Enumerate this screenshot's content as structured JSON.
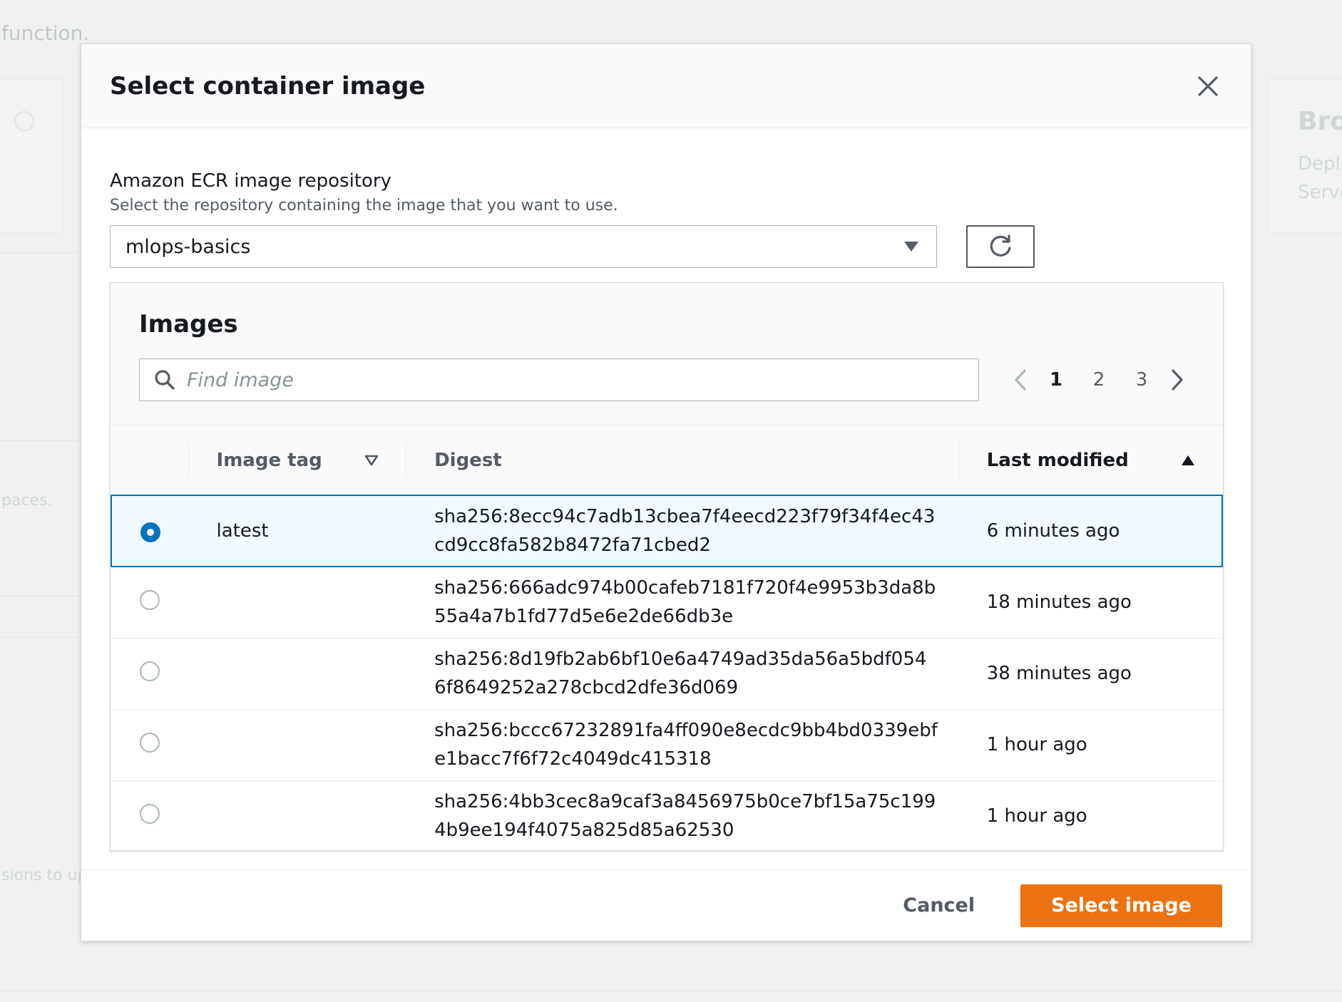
{
  "background": {
    "text_function": "function.",
    "text_spaces": "paces.",
    "text_sions": "sions to up",
    "card_title": "Brov",
    "card_sub_1": "Deplo",
    "card_sub_2": "Serve"
  },
  "modal": {
    "title": "Select container image",
    "close_icon": "close-icon"
  },
  "repository": {
    "label": "Amazon ECR image repository",
    "description": "Select the repository containing the image that you want to use.",
    "selected": "mlops-basics"
  },
  "images": {
    "title": "Images",
    "search_placeholder": "Find image",
    "pages": [
      "1",
      "2",
      "3"
    ],
    "current_page": "1",
    "columns": {
      "tag": "Image tag",
      "digest": "Digest",
      "modified": "Last modified"
    },
    "rows": [
      {
        "tag": "latest",
        "digest_1": "sha256:8ecc94c7adb13cbea7f4eecd223f79f34f4ec43",
        "digest_2": "cd9cc8fa582b8472fa71cbed2",
        "modified": "6 minutes ago",
        "selected": true
      },
      {
        "tag": "",
        "digest_1": "sha256:666adc974b00cafeb7181f720f4e9953b3da8b",
        "digest_2": "55a4a7b1fd77d5e6e2de66db3e",
        "modified": "18 minutes ago",
        "selected": false
      },
      {
        "tag": "",
        "digest_1": "sha256:8d19fb2ab6bf10e6a4749ad35da56a5bdf054",
        "digest_2": "6f8649252a278cbcd2dfe36d069",
        "modified": "38 minutes ago",
        "selected": false
      },
      {
        "tag": "",
        "digest_1": "sha256:bccc67232891fa4ff090e8ecdc9bb4bd0339ebf",
        "digest_2": "e1bacc7f6f72c4049dc415318",
        "modified": "1 hour ago",
        "selected": false
      },
      {
        "tag": "",
        "digest_1": "sha256:4bb3cec8a9caf3a8456975b0ce7bf15a75c199",
        "digest_2": "4b9ee194f4075a825d85a62530",
        "modified": "1 hour ago",
        "selected": false
      }
    ]
  },
  "footer": {
    "cancel_label": "Cancel",
    "select_label": "Select image"
  },
  "colors": {
    "primary": "#ec7211",
    "selection": "#0073bb"
  }
}
